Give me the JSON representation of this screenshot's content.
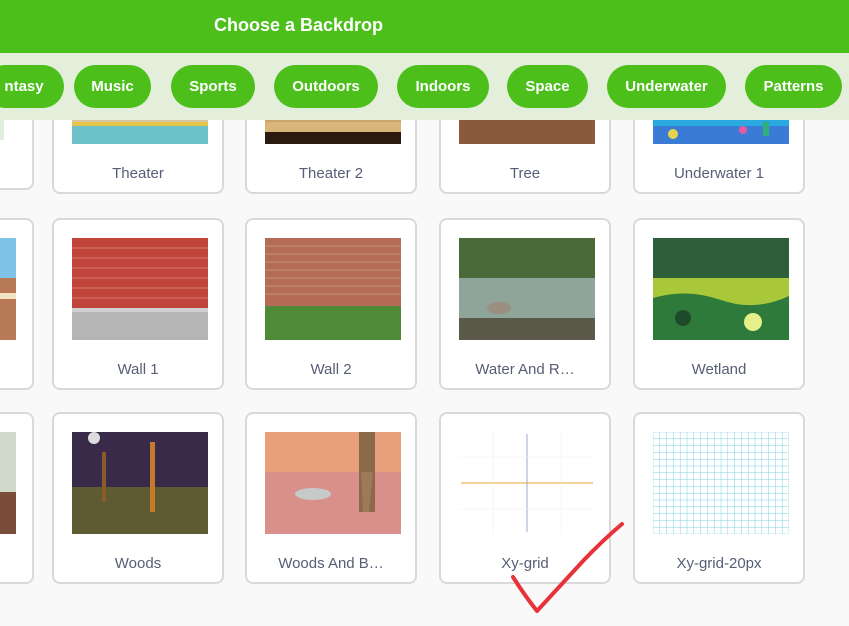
{
  "header": {
    "title": "Choose a Backdrop"
  },
  "filters": [
    "ntasy",
    "Music",
    "Sports",
    "Outdoors",
    "Indoors",
    "Space",
    "Underwater",
    "Patterns"
  ],
  "backdrops": [
    "Theater",
    "Theater 2",
    "Tree",
    "Underwater 1",
    "Wall 1",
    "Wall 2",
    "Water And R…",
    "Wetland",
    "Woods",
    "Woods And B…",
    "Xy-grid",
    "Xy-grid-20px"
  ],
  "annotation": {
    "checkmark_color": "#e8323a"
  },
  "colors": {
    "brand_green": "#4cbf1a",
    "filter_bar_bg": "#e3efdb",
    "label_text": "#575e75"
  }
}
